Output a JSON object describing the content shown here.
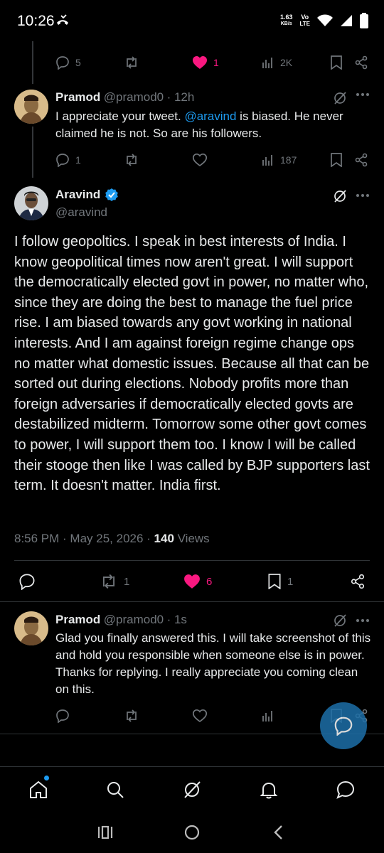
{
  "status_bar": {
    "time": "10:26",
    "net_speed": "1.63",
    "net_unit": "KB/s",
    "volte_top": "Vo",
    "volte_bottom": "LTE"
  },
  "reply1": {
    "replies": "5",
    "reposts": "",
    "likes": "1",
    "views": "2K"
  },
  "reply2": {
    "name": "Pramod",
    "handle": "@pramod0",
    "time": "· 12h",
    "text_before": "I appreciate your tweet. ",
    "mention": "@aravind",
    "text_after": "  is biased. He never claimed he is not. So are his followers.",
    "replies": "1",
    "views": "187"
  },
  "main_tweet": {
    "name": "Aravind",
    "handle": "@aravind",
    "text": "I follow geopoltics. I speak in best interests of India. I know geopolitical times now aren't great. I will support the democratically elected govt in power, no matter who, since they are doing the best to manage the fuel price rise. I am biased towards any govt working in national interests. And I am against foreign regime change ops no matter what domestic issues. Because all that can be sorted out during elections. Nobody profits more than foreign adversaries if democratically elected govts are destabilized midterm. Tomorrow some other govt comes to power, I will support them too. I know I will be called their stooge then like I was called by BJP supporters last term. It doesn't matter. India first.",
    "timestamp": "8:56 PM · May 25, 2026 · ",
    "views_count": "140",
    "views_label": " Views",
    "reposts": "1",
    "likes": "6",
    "bookmarks": "1"
  },
  "reply3": {
    "name": "Pramod",
    "handle": "@pramod0",
    "time": "· 1s",
    "text": "Glad you finally answered this. I will take screenshot of this and hold you responsible when someone else is in power. Thanks for replying. I really appreciate you coming clean on this."
  },
  "colors": {
    "like": "#f91880",
    "link": "#1d9bf0",
    "muted": "#71767b",
    "verified": "#1d9bf0",
    "fab": "#1d6fa8"
  }
}
